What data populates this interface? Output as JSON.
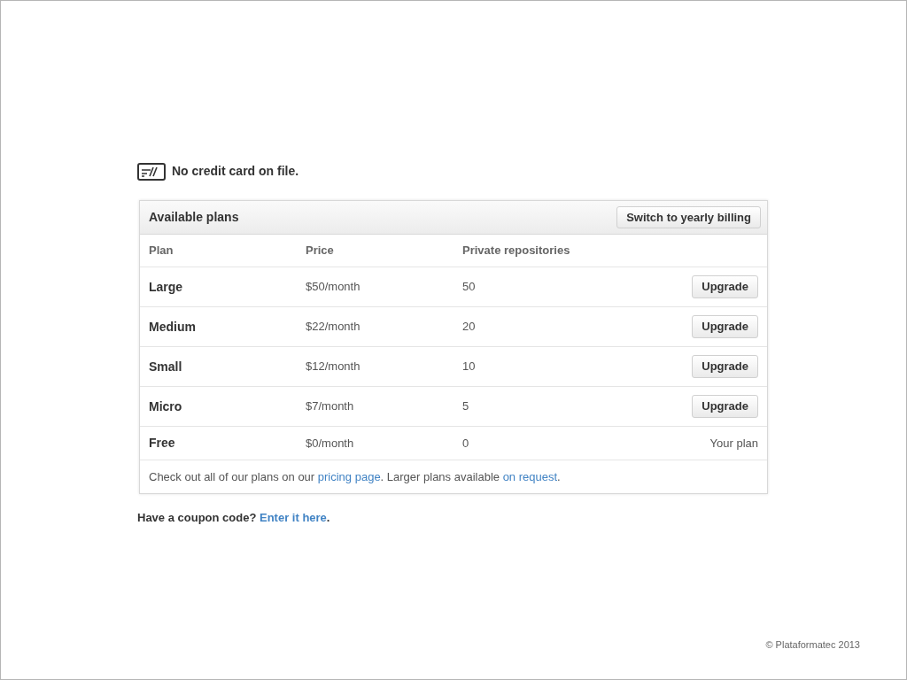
{
  "notice": {
    "text": "No credit card on file."
  },
  "plans_panel": {
    "title": "Available plans",
    "switch_button": "Switch to yearly billing",
    "columns": [
      "Plan",
      "Price",
      "Private repositories"
    ],
    "rows": [
      {
        "plan": "Large",
        "price": "$50/month",
        "repos": "50",
        "kind": "upgrade",
        "action": "Upgrade"
      },
      {
        "plan": "Medium",
        "price": "$22/month",
        "repos": "20",
        "kind": "upgrade",
        "action": "Upgrade"
      },
      {
        "plan": "Small",
        "price": "$12/month",
        "repos": "10",
        "kind": "upgrade",
        "action": "Upgrade"
      },
      {
        "plan": "Micro",
        "price": "$7/month",
        "repos": "5",
        "kind": "upgrade",
        "action": "Upgrade"
      },
      {
        "plan": "Free",
        "price": "$0/month",
        "repos": "0",
        "kind": "current",
        "action": "Your plan"
      }
    ],
    "footer": [
      {
        "kind": "text",
        "text": "Check out all of our plans on our "
      },
      {
        "kind": "link",
        "text": "pricing page"
      },
      {
        "kind": "text",
        "text": ". Larger plans available "
      },
      {
        "kind": "link",
        "text": "on request"
      },
      {
        "kind": "text",
        "text": "."
      }
    ]
  },
  "coupon": [
    {
      "kind": "text",
      "text": "Have a coupon code? "
    },
    {
      "kind": "link",
      "text": "Enter it here"
    },
    {
      "kind": "text",
      "text": "."
    }
  ],
  "copyright": "© Plataformatec 2013"
}
